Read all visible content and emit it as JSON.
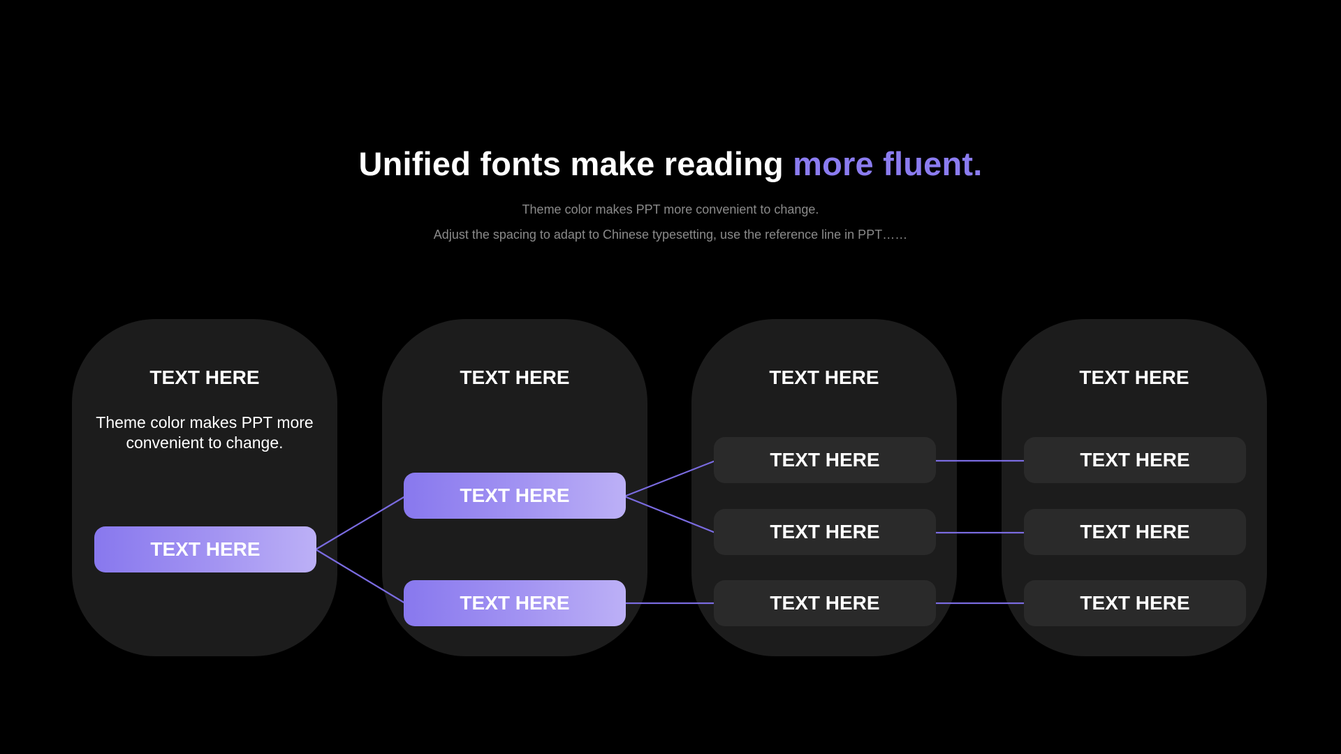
{
  "header": {
    "title_main": "Unified fonts make reading ",
    "title_accent": "more fluent.",
    "subtitle_line1": "Theme color makes PPT more convenient to change.",
    "subtitle_line2": "Adjust the spacing to adapt to Chinese typesetting, use the reference line in PPT……"
  },
  "columns": [
    {
      "title": "TEXT HERE",
      "description": "Theme color makes PPT more convenient to change.",
      "nodes": [
        {
          "label": "TEXT HERE"
        }
      ]
    },
    {
      "title": "TEXT HERE",
      "nodes": [
        {
          "label": "TEXT HERE"
        },
        {
          "label": "TEXT HERE"
        }
      ]
    },
    {
      "title": "TEXT HERE",
      "nodes": [
        {
          "label": "TEXT HERE"
        },
        {
          "label": "TEXT HERE"
        },
        {
          "label": "TEXT HERE"
        }
      ]
    },
    {
      "title": "TEXT HERE",
      "nodes": [
        {
          "label": "TEXT HERE"
        },
        {
          "label": "TEXT HERE"
        },
        {
          "label": "TEXT HERE"
        }
      ]
    }
  ],
  "colors": {
    "background": "#000000",
    "panel": "#1c1c1c",
    "node_dark": "#2a2a2a",
    "accent": "#8b7cf0",
    "connector": "#7a6be0"
  }
}
